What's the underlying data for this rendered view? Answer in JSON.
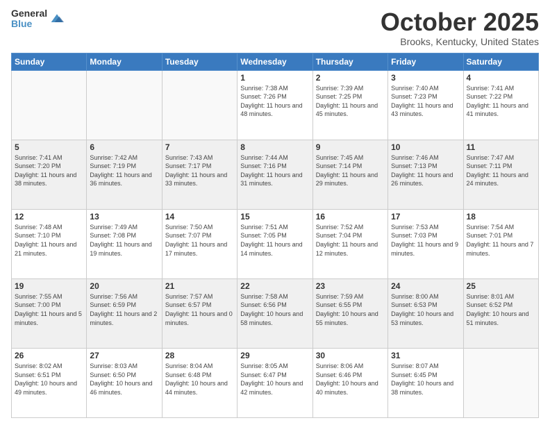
{
  "logo": {
    "line1": "General",
    "line2": "Blue"
  },
  "title": "October 2025",
  "location": "Brooks, Kentucky, United States",
  "days_of_week": [
    "Sunday",
    "Monday",
    "Tuesday",
    "Wednesday",
    "Thursday",
    "Friday",
    "Saturday"
  ],
  "weeks": [
    [
      {
        "day": "",
        "info": ""
      },
      {
        "day": "",
        "info": ""
      },
      {
        "day": "",
        "info": ""
      },
      {
        "day": "1",
        "info": "Sunrise: 7:38 AM\nSunset: 7:26 PM\nDaylight: 11 hours and 48 minutes."
      },
      {
        "day": "2",
        "info": "Sunrise: 7:39 AM\nSunset: 7:25 PM\nDaylight: 11 hours and 45 minutes."
      },
      {
        "day": "3",
        "info": "Sunrise: 7:40 AM\nSunset: 7:23 PM\nDaylight: 11 hours and 43 minutes."
      },
      {
        "day": "4",
        "info": "Sunrise: 7:41 AM\nSunset: 7:22 PM\nDaylight: 11 hours and 41 minutes."
      }
    ],
    [
      {
        "day": "5",
        "info": "Sunrise: 7:41 AM\nSunset: 7:20 PM\nDaylight: 11 hours and 38 minutes."
      },
      {
        "day": "6",
        "info": "Sunrise: 7:42 AM\nSunset: 7:19 PM\nDaylight: 11 hours and 36 minutes."
      },
      {
        "day": "7",
        "info": "Sunrise: 7:43 AM\nSunset: 7:17 PM\nDaylight: 11 hours and 33 minutes."
      },
      {
        "day": "8",
        "info": "Sunrise: 7:44 AM\nSunset: 7:16 PM\nDaylight: 11 hours and 31 minutes."
      },
      {
        "day": "9",
        "info": "Sunrise: 7:45 AM\nSunset: 7:14 PM\nDaylight: 11 hours and 29 minutes."
      },
      {
        "day": "10",
        "info": "Sunrise: 7:46 AM\nSunset: 7:13 PM\nDaylight: 11 hours and 26 minutes."
      },
      {
        "day": "11",
        "info": "Sunrise: 7:47 AM\nSunset: 7:11 PM\nDaylight: 11 hours and 24 minutes."
      }
    ],
    [
      {
        "day": "12",
        "info": "Sunrise: 7:48 AM\nSunset: 7:10 PM\nDaylight: 11 hours and 21 minutes."
      },
      {
        "day": "13",
        "info": "Sunrise: 7:49 AM\nSunset: 7:08 PM\nDaylight: 11 hours and 19 minutes."
      },
      {
        "day": "14",
        "info": "Sunrise: 7:50 AM\nSunset: 7:07 PM\nDaylight: 11 hours and 17 minutes."
      },
      {
        "day": "15",
        "info": "Sunrise: 7:51 AM\nSunset: 7:05 PM\nDaylight: 11 hours and 14 minutes."
      },
      {
        "day": "16",
        "info": "Sunrise: 7:52 AM\nSunset: 7:04 PM\nDaylight: 11 hours and 12 minutes."
      },
      {
        "day": "17",
        "info": "Sunrise: 7:53 AM\nSunset: 7:03 PM\nDaylight: 11 hours and 9 minutes."
      },
      {
        "day": "18",
        "info": "Sunrise: 7:54 AM\nSunset: 7:01 PM\nDaylight: 11 hours and 7 minutes."
      }
    ],
    [
      {
        "day": "19",
        "info": "Sunrise: 7:55 AM\nSunset: 7:00 PM\nDaylight: 11 hours and 5 minutes."
      },
      {
        "day": "20",
        "info": "Sunrise: 7:56 AM\nSunset: 6:59 PM\nDaylight: 11 hours and 2 minutes."
      },
      {
        "day": "21",
        "info": "Sunrise: 7:57 AM\nSunset: 6:57 PM\nDaylight: 11 hours and 0 minutes."
      },
      {
        "day": "22",
        "info": "Sunrise: 7:58 AM\nSunset: 6:56 PM\nDaylight: 10 hours and 58 minutes."
      },
      {
        "day": "23",
        "info": "Sunrise: 7:59 AM\nSunset: 6:55 PM\nDaylight: 10 hours and 55 minutes."
      },
      {
        "day": "24",
        "info": "Sunrise: 8:00 AM\nSunset: 6:53 PM\nDaylight: 10 hours and 53 minutes."
      },
      {
        "day": "25",
        "info": "Sunrise: 8:01 AM\nSunset: 6:52 PM\nDaylight: 10 hours and 51 minutes."
      }
    ],
    [
      {
        "day": "26",
        "info": "Sunrise: 8:02 AM\nSunset: 6:51 PM\nDaylight: 10 hours and 49 minutes."
      },
      {
        "day": "27",
        "info": "Sunrise: 8:03 AM\nSunset: 6:50 PM\nDaylight: 10 hours and 46 minutes."
      },
      {
        "day": "28",
        "info": "Sunrise: 8:04 AM\nSunset: 6:48 PM\nDaylight: 10 hours and 44 minutes."
      },
      {
        "day": "29",
        "info": "Sunrise: 8:05 AM\nSunset: 6:47 PM\nDaylight: 10 hours and 42 minutes."
      },
      {
        "day": "30",
        "info": "Sunrise: 8:06 AM\nSunset: 6:46 PM\nDaylight: 10 hours and 40 minutes."
      },
      {
        "day": "31",
        "info": "Sunrise: 8:07 AM\nSunset: 6:45 PM\nDaylight: 10 hours and 38 minutes."
      },
      {
        "day": "",
        "info": ""
      }
    ]
  ]
}
